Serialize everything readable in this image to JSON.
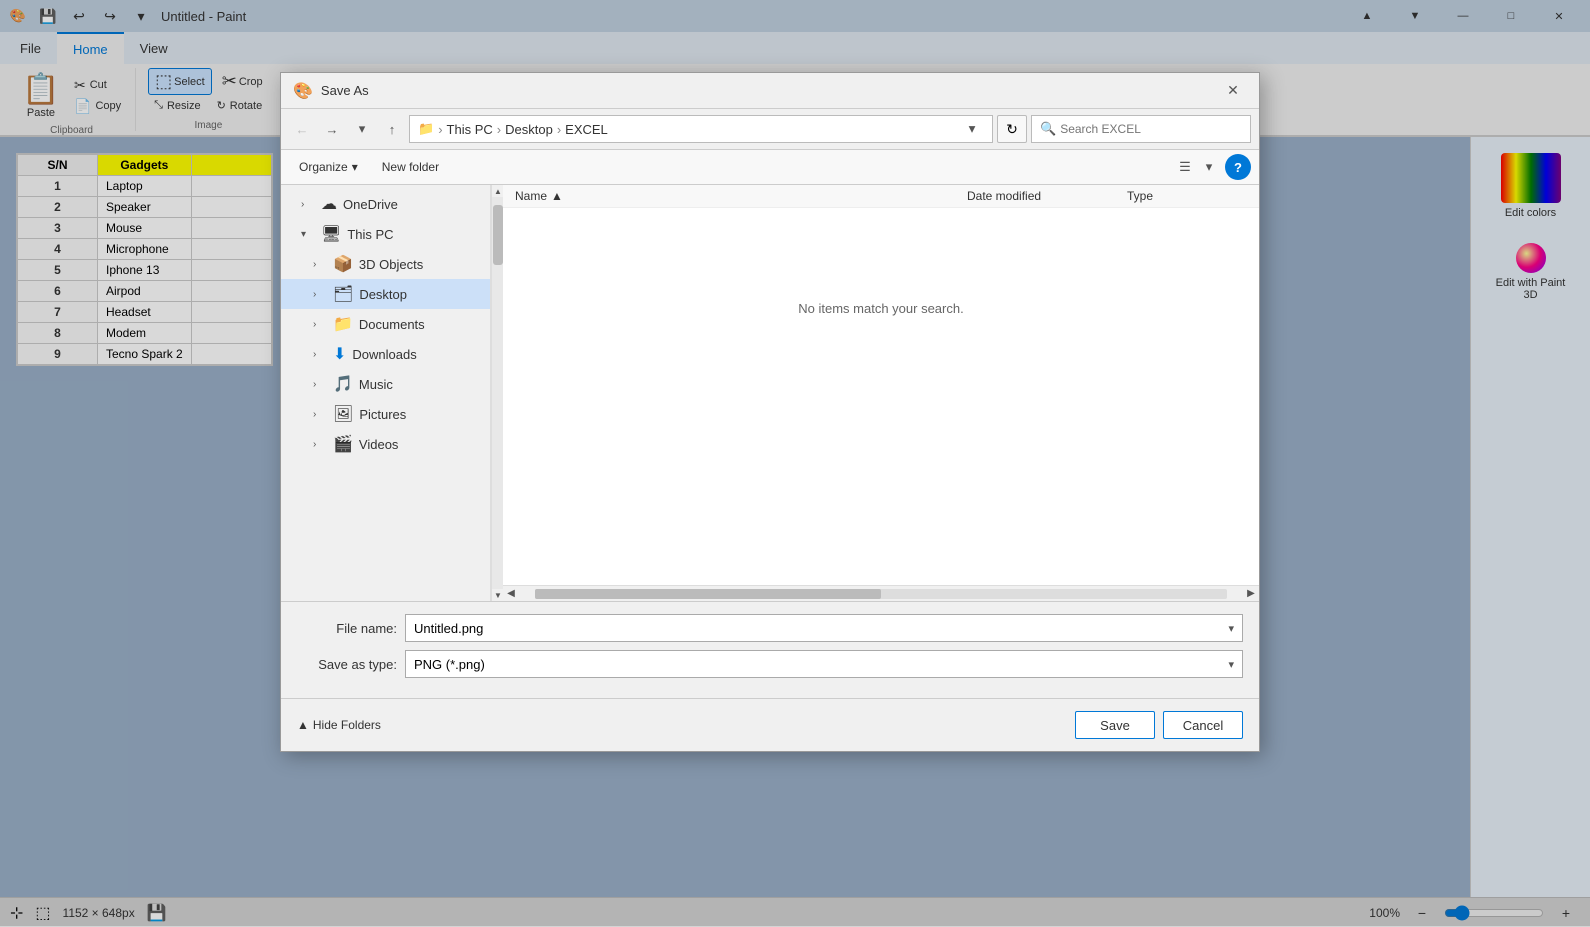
{
  "window": {
    "title": "Untitled - Paint",
    "app_icon": "🎨"
  },
  "titlebar": {
    "save_label": "💾",
    "undo_label": "↩",
    "redo_label": "↪",
    "dropdown_label": "▾",
    "minimize": "—",
    "maximize": "□",
    "close": "✕",
    "nav_up": "▲",
    "nav_down": "▼"
  },
  "ribbon": {
    "tabs": [
      "File",
      "Home",
      "View"
    ],
    "active_tab": "Home",
    "groups": {
      "clipboard": {
        "label": "Clipboard",
        "paste_label": "Paste",
        "cut_label": "Cut",
        "copy_label": "Copy"
      },
      "image": {
        "label": "Image",
        "crop_label": "Crop",
        "resize_label": "Resize",
        "rotate_label": "Rotate",
        "select_label": "Select"
      }
    }
  },
  "spreadsheet": {
    "headers": [
      "S/N",
      "Gadgets"
    ],
    "rows": [
      {
        "sn": "1",
        "item": "Laptop"
      },
      {
        "sn": "2",
        "item": "Speaker"
      },
      {
        "sn": "3",
        "item": "Mouse"
      },
      {
        "sn": "4",
        "item": "Microphone"
      },
      {
        "sn": "5",
        "item": "Iphone 13"
      },
      {
        "sn": "6",
        "item": "Airpod"
      },
      {
        "sn": "7",
        "item": "Headset"
      },
      {
        "sn": "8",
        "item": "Modem"
      },
      {
        "sn": "9",
        "item": "Tecno Spark 2"
      }
    ]
  },
  "right_panel": {
    "edit_colors_label": "Edit colors",
    "edit_paint3d_label": "Edit with Paint 3D"
  },
  "status_bar": {
    "dimensions": "1152 × 648px",
    "zoom_level": "100%",
    "zoom_minus": "−",
    "zoom_plus": "+"
  },
  "dialog": {
    "title": "Save As",
    "title_icon": "🎨",
    "address": {
      "this_pc": "This PC",
      "desktop": "Desktop",
      "excel": "EXCEL"
    },
    "search_placeholder": "Search EXCEL",
    "toolbar": {
      "organize_label": "Organize",
      "new_folder_label": "New folder"
    },
    "sidebar": {
      "items": [
        {
          "label": "OneDrive",
          "icon": "☁",
          "expanded": false,
          "indent": 1
        },
        {
          "label": "This PC",
          "icon": "🖥",
          "expanded": true,
          "indent": 1
        },
        {
          "label": "3D Objects",
          "icon": "📦",
          "expanded": false,
          "indent": 2
        },
        {
          "label": "Desktop",
          "icon": "🗂",
          "expanded": false,
          "indent": 2,
          "active": true
        },
        {
          "label": "Documents",
          "icon": "📁",
          "expanded": false,
          "indent": 2
        },
        {
          "label": "Downloads",
          "icon": "⬇",
          "expanded": false,
          "indent": 2
        },
        {
          "label": "Music",
          "icon": "🎵",
          "expanded": false,
          "indent": 2
        },
        {
          "label": "Pictures",
          "icon": "🖼",
          "expanded": false,
          "indent": 2
        },
        {
          "label": "Videos",
          "icon": "🎬",
          "expanded": false,
          "indent": 2
        }
      ]
    },
    "file_list": {
      "columns": [
        "Name",
        "Date modified",
        "Type"
      ],
      "empty_message": "No items match your search."
    },
    "filename": {
      "label": "File name:",
      "value": "Untitled.png",
      "placeholder": "Untitled.png"
    },
    "savetype": {
      "label": "Save as type:",
      "value": "PNG (*.png)"
    },
    "footer": {
      "hide_folders_label": "Hide Folders",
      "save_label": "Save",
      "cancel_label": "Cancel"
    }
  }
}
